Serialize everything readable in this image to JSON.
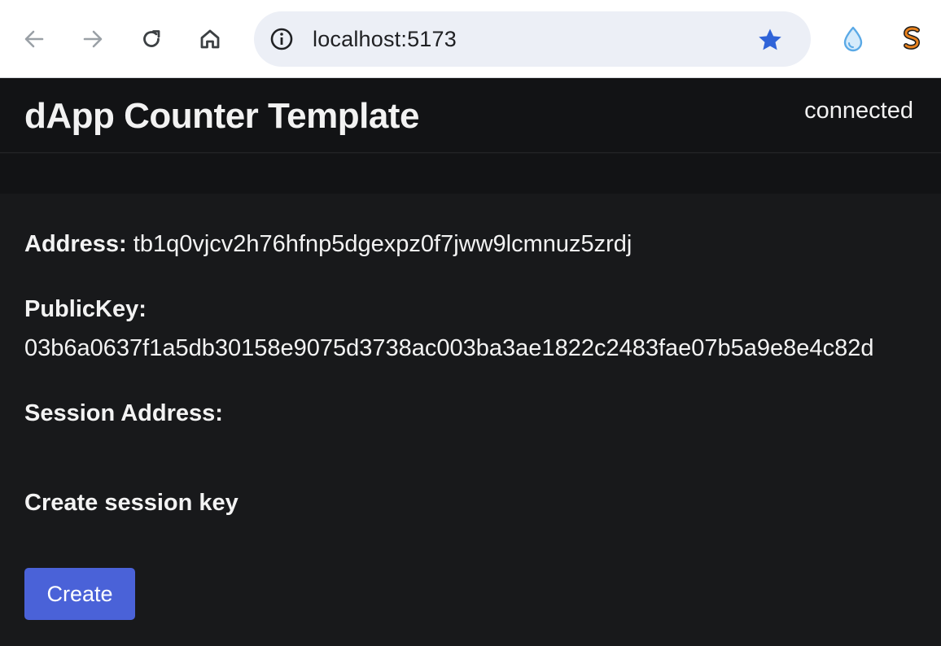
{
  "browser": {
    "url": "localhost:5173"
  },
  "app": {
    "title": "dApp Counter Template",
    "status": "connected"
  },
  "wallet": {
    "address_label": "Address:",
    "address_value": "tb1q0vjcv2h76hfnp5dgexpz0f7jww9lcmnuz5zrdj",
    "pubkey_label": "PublicKey:",
    "pubkey_value": "03b6a0637f1a5db30158e9075d3738ac003ba3ae1822c2483fae07b5a9e8e4c82d",
    "session_label": "Session Address:"
  },
  "session": {
    "title": "Create session key",
    "button_label": "Create"
  },
  "colors": {
    "accent_button": "#4a62d8",
    "bookmark_star": "#2f63d8",
    "background": "#18191b"
  },
  "icons": [
    "back-arrow-icon",
    "forward-arrow-icon",
    "reload-icon",
    "home-icon",
    "site-info-icon",
    "bookmark-star-icon",
    "droplet-extension-icon",
    "s-extension-icon"
  ]
}
